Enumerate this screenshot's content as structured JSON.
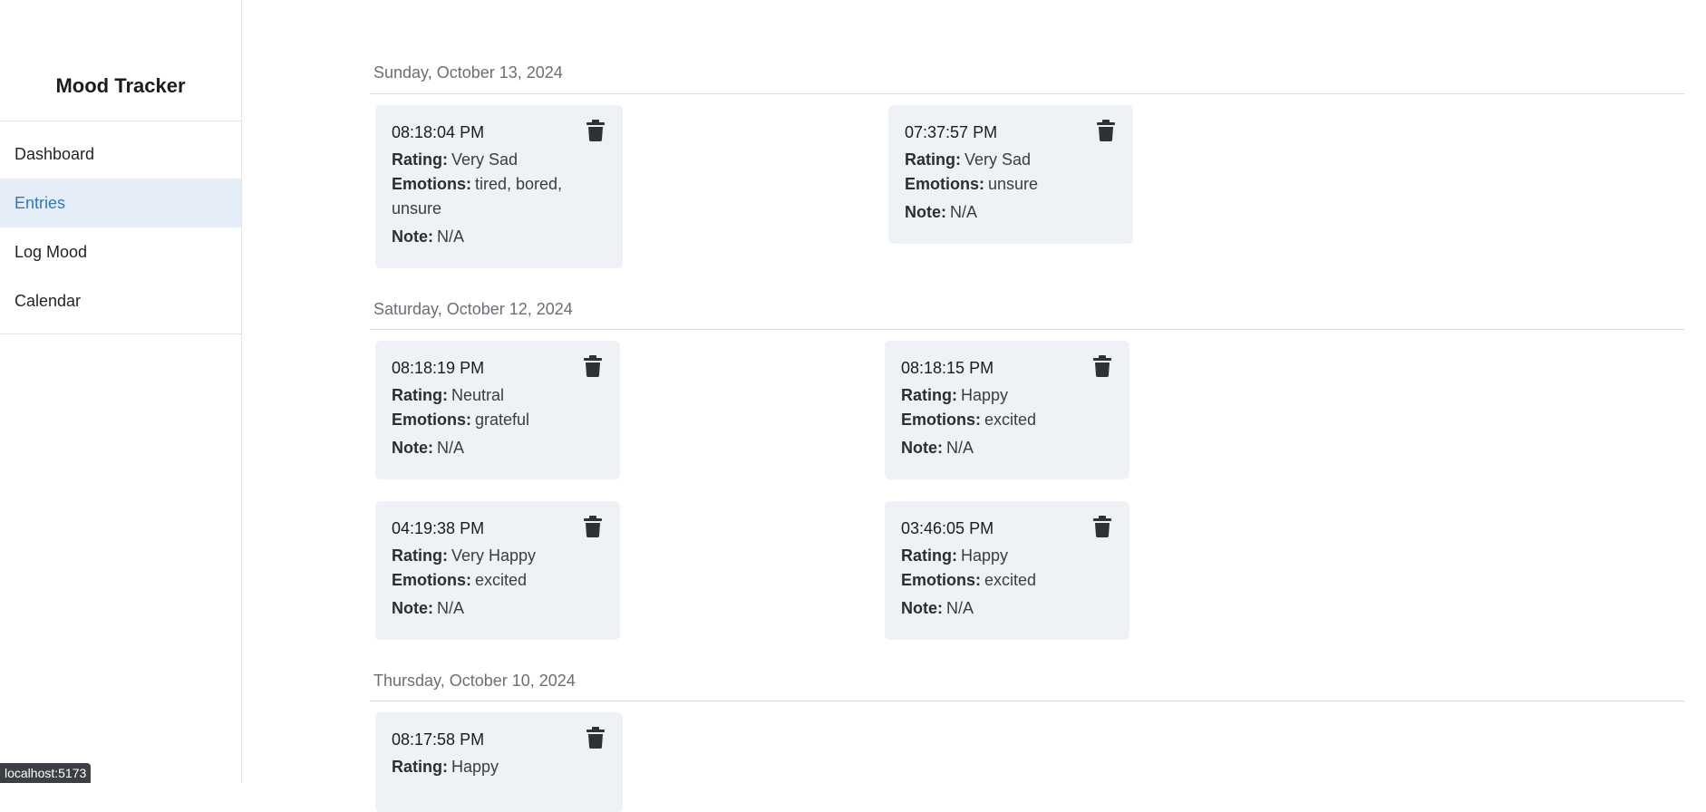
{
  "app": {
    "title": "Mood Tracker"
  },
  "sidebar": {
    "items": [
      {
        "label": "Dashboard",
        "active": false
      },
      {
        "label": "Entries",
        "active": true
      },
      {
        "label": "Log Mood",
        "active": false
      },
      {
        "label": "Calendar",
        "active": false
      }
    ]
  },
  "labels": {
    "rating": "Rating:",
    "emotions": "Emotions:",
    "note": "Note:"
  },
  "groups": [
    {
      "date": "Sunday, October 13, 2024",
      "entries": [
        {
          "time": "08:18:04 PM",
          "rating": "Very Sad",
          "emotions": "tired, bored, unsure",
          "note": "N/A"
        },
        {
          "time": "07:37:57 PM",
          "rating": "Very Sad",
          "emotions": "unsure",
          "note": "N/A"
        }
      ]
    },
    {
      "date": "Saturday, October 12, 2024",
      "entries": [
        {
          "time": "08:18:19 PM",
          "rating": "Neutral",
          "emotions": "grateful",
          "note": "N/A"
        },
        {
          "time": "08:18:15 PM",
          "rating": "Happy",
          "emotions": "excited",
          "note": "N/A"
        },
        {
          "time": "04:19:38 PM",
          "rating": "Very Happy",
          "emotions": "excited",
          "note": "N/A"
        },
        {
          "time": "03:46:05 PM",
          "rating": "Happy",
          "emotions": "excited",
          "note": "N/A"
        }
      ]
    },
    {
      "date": "Thursday, October 10, 2024",
      "entries": [
        {
          "time": "08:17:58 PM",
          "rating": "Happy",
          "emotions": "",
          "note": ""
        }
      ]
    }
  ],
  "status_bar": {
    "url": "localhost:5173"
  },
  "colors": {
    "accent": "#2f78c4",
    "active_bg": "#e4edf8",
    "card_bg": "#eef1f6"
  },
  "icons": {
    "delete": "trash-icon"
  }
}
